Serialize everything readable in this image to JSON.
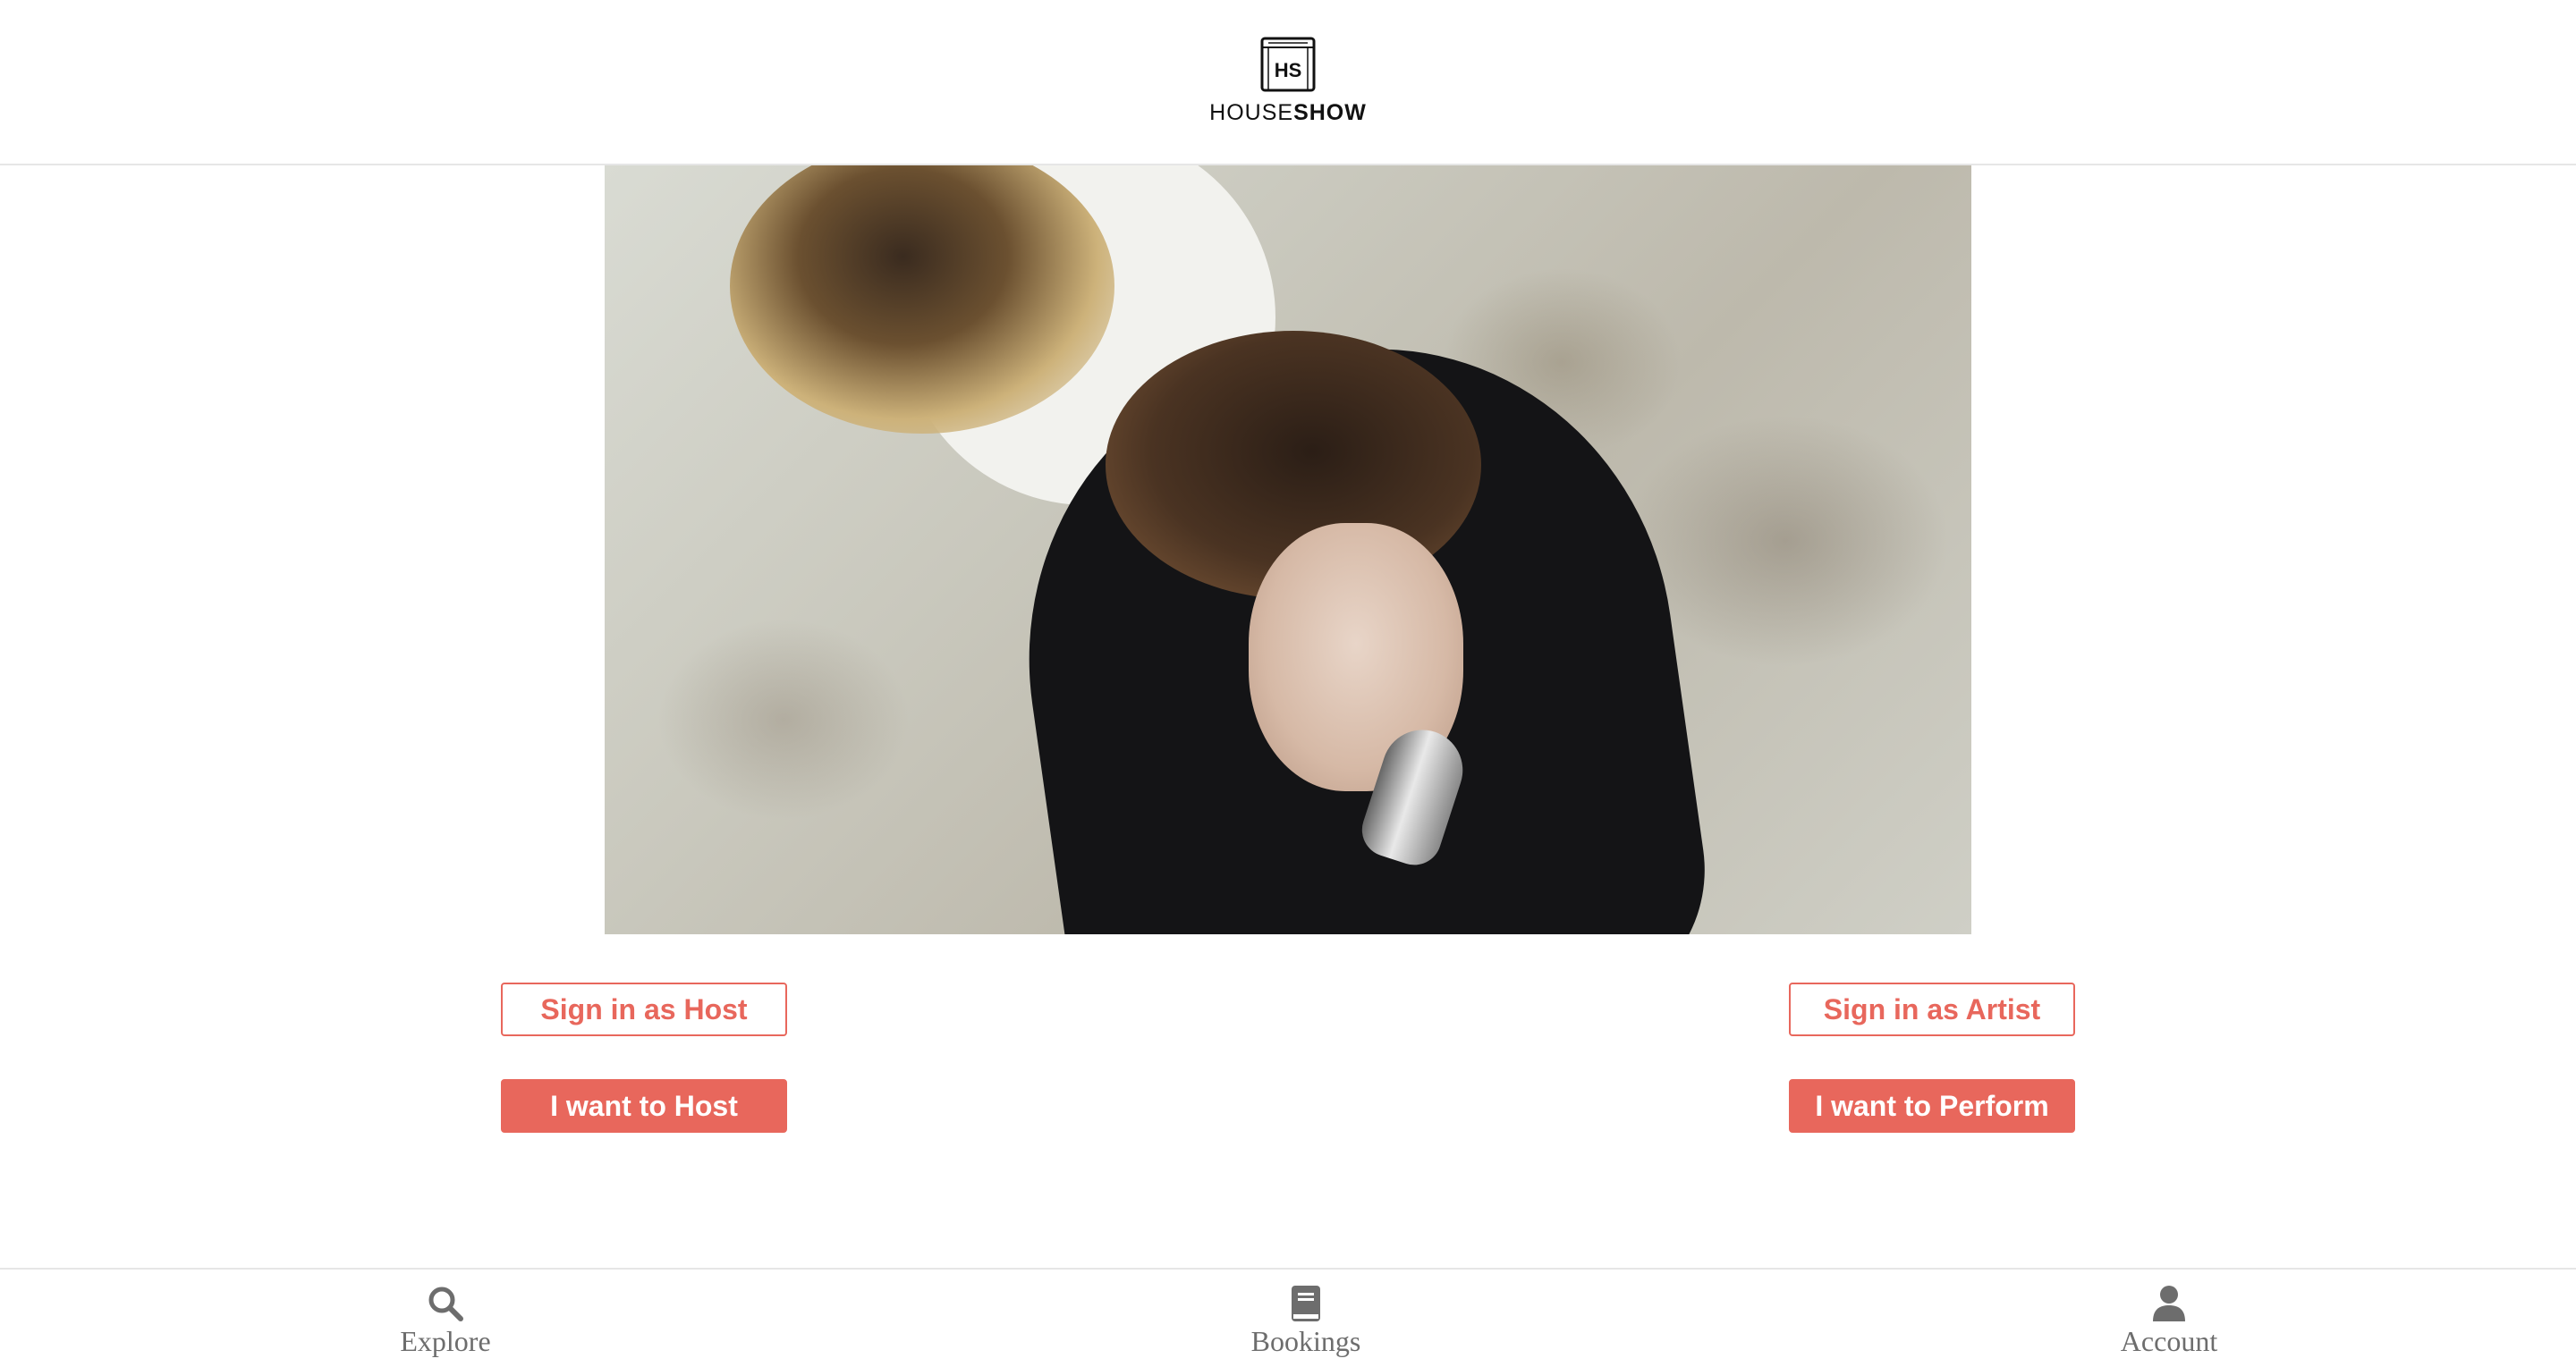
{
  "header": {
    "logo_text_light": "HOUSE",
    "logo_text_bold": "SHOW",
    "logo_mark_text": "HS"
  },
  "hero": {
    "image_description_icon": "hero-photo"
  },
  "actions": {
    "sign_in_host": "Sign in as Host",
    "sign_in_artist": "Sign in as Artist",
    "want_host": "I want to Host",
    "want_perform": "I want to Perform"
  },
  "bottom_nav": {
    "items": [
      {
        "label": "Explore",
        "icon": "search-icon"
      },
      {
        "label": "Bookings",
        "icon": "book-icon"
      },
      {
        "label": "Account",
        "icon": "user-icon"
      }
    ]
  },
  "colors": {
    "accent": "#e8675c",
    "nav_text": "#6d6d6d",
    "divider": "#e6e6e6"
  }
}
